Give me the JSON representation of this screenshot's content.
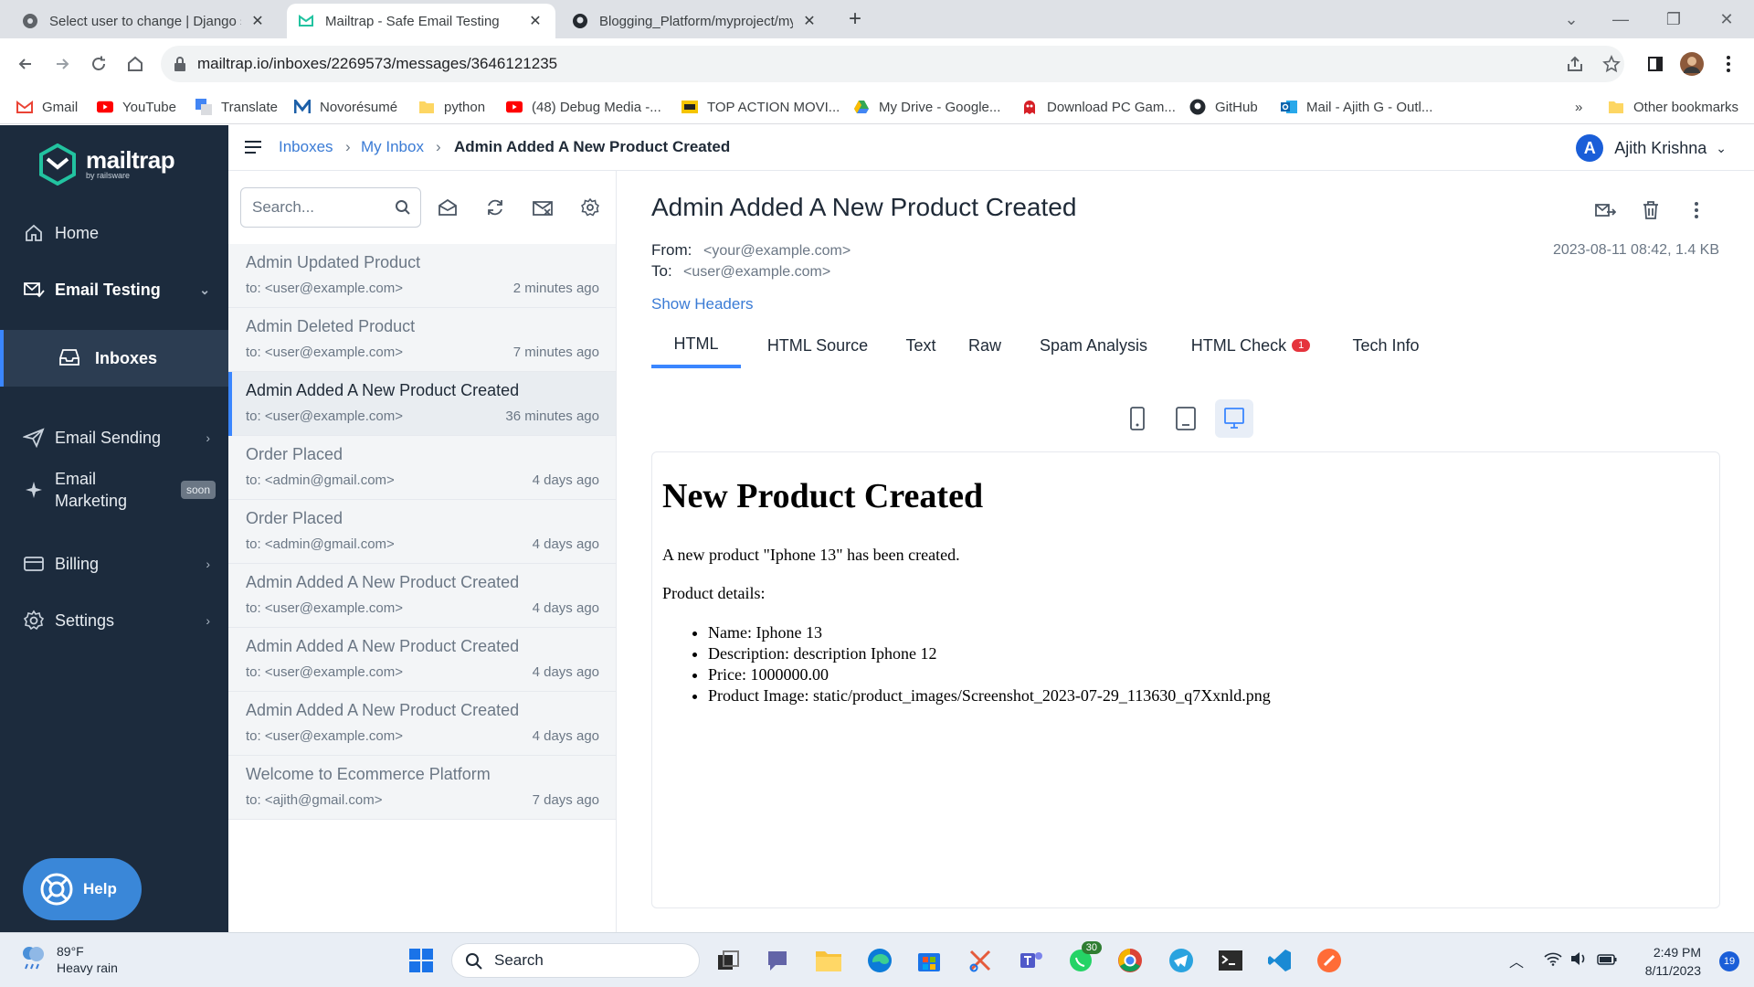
{
  "browser": {
    "tabs": [
      {
        "title": "Select user to change | Django si",
        "close": "✕",
        "active": false
      },
      {
        "title": "Mailtrap - Safe Email Testing",
        "close": "✕",
        "active": true
      },
      {
        "title": "Blogging_Platform/myproject/my",
        "close": "✕",
        "active": false
      }
    ],
    "new_tab": "+",
    "url": "mailtrap.io/inboxes/2269573/messages/3646121235",
    "bookmarks": [
      {
        "label": "Gmail",
        "icon": "gmail-icon"
      },
      {
        "label": "YouTube",
        "icon": "youtube-icon"
      },
      {
        "label": "Translate",
        "icon": "translate-icon"
      },
      {
        "label": "Novorésumé",
        "icon": "novoresume-icon"
      },
      {
        "label": "python",
        "icon": "folder-icon"
      },
      {
        "label": "(48) Debug Media -...",
        "icon": "youtube-icon"
      },
      {
        "label": "TOP ACTION MOVI...",
        "icon": "movie-icon"
      },
      {
        "label": "My Drive - Google...",
        "icon": "google-drive-icon"
      },
      {
        "label": "Download PC Gam...",
        "icon": "game-icon"
      },
      {
        "label": "GitHub",
        "icon": "github-icon"
      },
      {
        "label": "Mail - Ajith G - Outl...",
        "icon": "outlook-icon"
      }
    ],
    "more_bookmarks": "»",
    "other_bookmarks": "Other bookmarks"
  },
  "sidebar": {
    "logo_name": "mailtrap",
    "logo_by": "by railsware",
    "items": [
      {
        "label": "Home",
        "icon": "home-icon"
      },
      {
        "label": "Email Testing",
        "icon": "email-testing-icon"
      },
      {
        "label": "Inboxes",
        "icon": "inbox-icon"
      },
      {
        "label": "Email Sending",
        "icon": "send-icon"
      },
      {
        "label": "Email",
        "label2": "Marketing",
        "icon": "sparkle-icon",
        "badge": "soon"
      },
      {
        "label": "Billing",
        "icon": "billing-icon"
      },
      {
        "label": "Settings",
        "icon": "settings-icon"
      }
    ],
    "help": "Help"
  },
  "header": {
    "crumbs": [
      "Inboxes",
      "My Inbox",
      "Admin Added A New Product Created"
    ],
    "separator": "›",
    "user_initial": "A",
    "user_name": "Ajith Krishna"
  },
  "list": {
    "search_placeholder": "Search...",
    "messages": [
      {
        "subject": "Admin Updated Product",
        "to": "to: <user@example.com>",
        "time": "2 minutes ago"
      },
      {
        "subject": "Admin Deleted Product",
        "to": "to: <user@example.com>",
        "time": "7 minutes ago"
      },
      {
        "subject": "Admin Added A New Product Created",
        "to": "to: <user@example.com>",
        "time": "36 minutes ago",
        "selected": true
      },
      {
        "subject": "Order Placed",
        "to": "to: <admin@gmail.com>",
        "time": "4 days ago"
      },
      {
        "subject": "Order Placed",
        "to": "to: <admin@gmail.com>",
        "time": "4 days ago"
      },
      {
        "subject": "Admin Added A New Product Created",
        "to": "to: <user@example.com>",
        "time": "4 days ago"
      },
      {
        "subject": "Admin Added A New Product Created",
        "to": "to: <user@example.com>",
        "time": "4 days ago"
      },
      {
        "subject": "Admin Added A New Product Created",
        "to": "to: <user@example.com>",
        "time": "4 days ago"
      },
      {
        "subject": "Welcome to Ecommerce Platform",
        "to": "to: <ajith@gmail.com>",
        "time": "7 days ago"
      }
    ]
  },
  "message": {
    "subject": "Admin Added A New Product Created",
    "from_label": "From:",
    "from": "<your@example.com>",
    "to_label": "To:",
    "to": "<user@example.com>",
    "meta": "2023-08-11 08:42, 1.4 KB",
    "show_headers": "Show Headers",
    "tabs": [
      {
        "label": "HTML",
        "active": true
      },
      {
        "label": "HTML Source"
      },
      {
        "label": "Text"
      },
      {
        "label": "Raw"
      },
      {
        "label": "Spam Analysis"
      },
      {
        "label": "HTML Check",
        "badge": "1"
      },
      {
        "label": "Tech Info"
      }
    ],
    "body": {
      "heading": "New Product Created",
      "intro": "A new product \"Iphone 13\" has been created.",
      "details_label": "Product details:",
      "details": [
        "Name: Iphone 13",
        "Description: description Iphone 12",
        "Price: 1000000.00",
        "Product Image: static/product_images/Screenshot_2023-07-29_113630_q7Xxnld.png"
      ]
    }
  },
  "taskbar": {
    "temp": "89°F",
    "condition": "Heavy rain",
    "search": "Search",
    "teams_badge": "30",
    "time": "2:49 PM",
    "date": "8/11/2023",
    "notifications": "19"
  }
}
